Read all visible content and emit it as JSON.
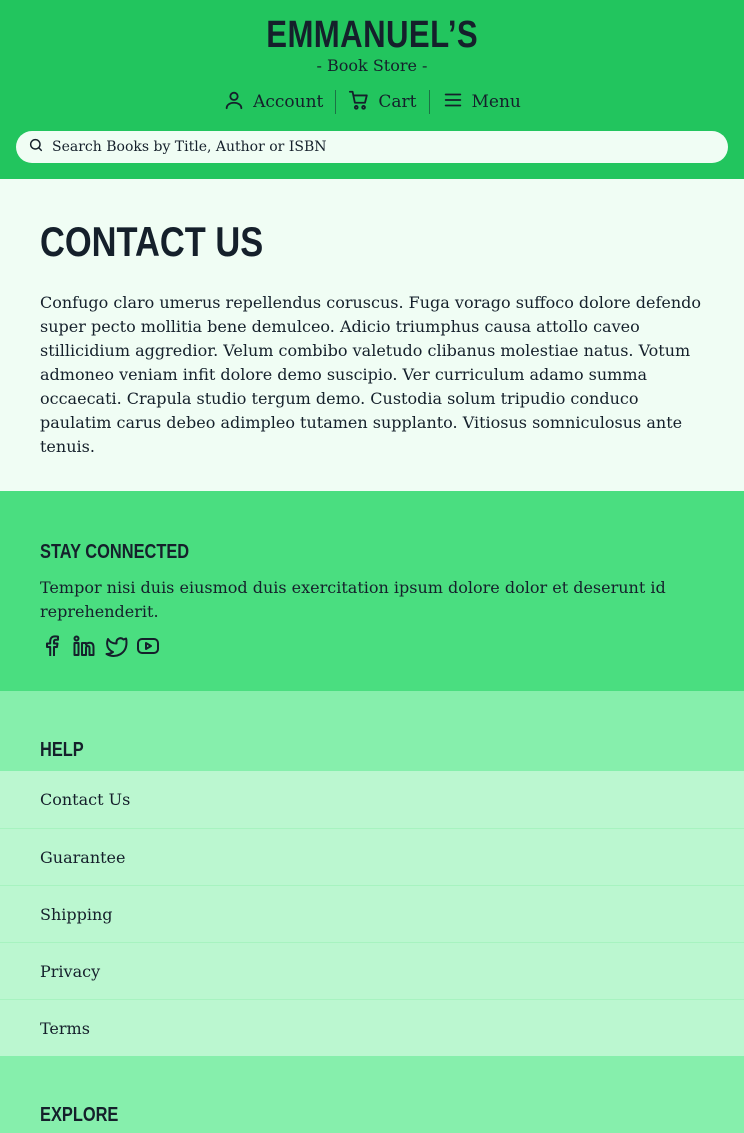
{
  "brand": {
    "name": "EMMANUEL’S",
    "subtitle": "- Book Store -"
  },
  "nav": {
    "account": "Account",
    "cart": "Cart",
    "menu": "Menu"
  },
  "search": {
    "placeholder": "Search Books by Title, Author or ISBN"
  },
  "main": {
    "title": "CONTACT US",
    "body": "Confugo claro umerus repellendus coruscus. Fuga vorago suffoco dolore defendo super pecto mollitia bene demulceo. Adicio triumphus causa attollo caveo stillicidium aggredior. Velum combibo valetudo clibanus molestiae natus. Votum admoneo veniam infit dolore demo suscipio. Ver curriculum adamo summa occaecati. Crapula studio tergum demo. Custodia solum tripudio conduco paulatim carus debeo adimpleo tutamen supplanto. Vitiosus somniculosus ante tenuis."
  },
  "stay_connected": {
    "heading": "STAY CONNECTED",
    "text": "Tempor nisi duis eiusmod duis exercitation ipsum dolore dolor et deserunt id reprehenderit.",
    "icons": [
      "facebook-icon",
      "linkedin-icon",
      "twitter-icon",
      "youtube-icon"
    ]
  },
  "help": {
    "heading": "HELP",
    "items": [
      "Contact Us",
      "Guarantee",
      "Shipping",
      "Privacy",
      "Terms"
    ]
  },
  "explore": {
    "heading": "EXPLORE"
  },
  "colors": {
    "header": "#22c55e",
    "stay": "#4ade80",
    "section": "#86efac",
    "list": "#bbf7d0",
    "page": "#f0fdf4",
    "text": "#15202b"
  }
}
